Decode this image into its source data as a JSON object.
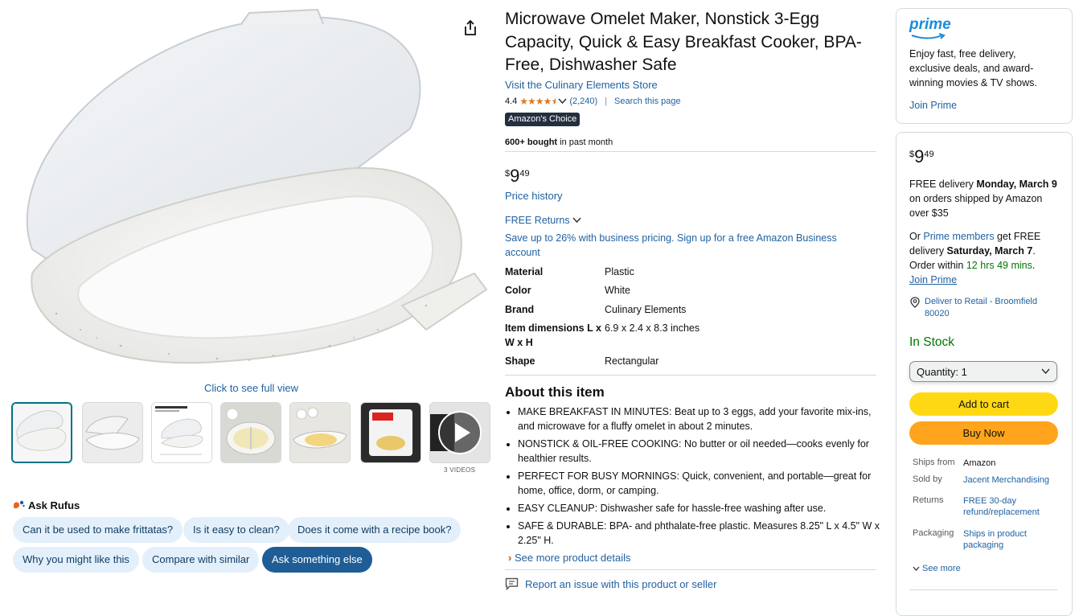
{
  "gallery": {
    "full_view": "Click to see full view",
    "videos_label": "3 VIDEOS"
  },
  "rufus": {
    "title": "Ask Rufus",
    "chips": [
      "Can it be used to make frittatas?",
      "Is it easy to clean?",
      "Does it come with a recipe book?",
      "Why you might like this",
      "Compare with similar",
      "Ask something else"
    ]
  },
  "product": {
    "title": "Microwave Omelet Maker, Nonstick 3-Egg Capacity, Quick & Easy Breakfast Cooker, BPA-Free, Dishwasher Safe",
    "store": "Visit the Culinary Elements Store",
    "rating": "4.4",
    "reviews": "(2,240)",
    "search_page": "Search this page",
    "badge": "Amazon's Choice",
    "bought_bold": "600+ bought",
    "bought_rest": " in past month",
    "price_symbol": "$",
    "price_dollars": "9",
    "price_cents": "49",
    "price_history": "Price history",
    "free_returns": "FREE Returns",
    "business": "Save up to 26% with business pricing. Sign up for a free Amazon Business account",
    "specs": [
      {
        "k": "Material",
        "v": "Plastic"
      },
      {
        "k": "Color",
        "v": "White"
      },
      {
        "k": "Brand",
        "v": "Culinary Elements"
      },
      {
        "k": "Item dimensions L x W x H",
        "v": "6.9 x 2.4 x 8.3 inches"
      },
      {
        "k": "Shape",
        "v": "Rectangular"
      }
    ],
    "about_title": "About this item",
    "bullets": [
      "MAKE BREAKFAST IN MINUTES: Beat up to 3 eggs, add your favorite mix-ins, and microwave for a fluffy omelet in about 2 minutes.",
      "NONSTICK & OIL-FREE COOKING: No butter or oil needed—cooks evenly for healthier results.",
      "PERFECT FOR BUSY MORNINGS: Quick, convenient, and portable—great for home, office, dorm, or camping.",
      "EASY CLEANUP: Dishwasher safe for hassle-free washing after use.",
      "SAFE & DURABLE: BPA- and phthalate-free plastic. Measures 8.25\" L x 4.5\" W x 2.25\" H."
    ],
    "see_more_details": "See more product details",
    "report": "Report an issue with this product or seller"
  },
  "prime_box": {
    "logo": "prime",
    "text": "Enjoy fast, free delivery, exclusive deals, and award-winning movies & TV shows.",
    "join": "Join Prime"
  },
  "buy_box": {
    "delivery_pre": "FREE delivery ",
    "delivery_date": "Monday, March 9",
    "delivery_post": " on orders shipped by Amazon over $35",
    "or": "Or ",
    "prime_members": "Prime members",
    "get_free": " get FREE delivery ",
    "fast_date": "Saturday, March 7",
    "order_within": ". Order within ",
    "countdown": "12 hrs 49 mins",
    "period": ".",
    "join_prime": "Join Prime",
    "deliver_to": "Deliver to Retail - Broomfield 80020",
    "stock": "In Stock",
    "quantity": "Quantity:  1",
    "add_to_cart": "Add to cart",
    "buy_now": "Buy Now",
    "ships_from_k": "Ships from",
    "ships_from_v": "Amazon",
    "sold_by_k": "Sold by",
    "sold_by_v": "Jacent Merchandising",
    "returns_k": "Returns",
    "returns_v": "FREE 30-day refund/replacement",
    "packaging_k": "Packaging",
    "packaging_v": "Ships in product packaging",
    "see_more": "See more"
  },
  "colors": {
    "link": "#2162a1",
    "add_to_cart": "#ffd814",
    "buy_now": "#ffa41c",
    "in_stock": "#007600",
    "star": "#de7921"
  }
}
